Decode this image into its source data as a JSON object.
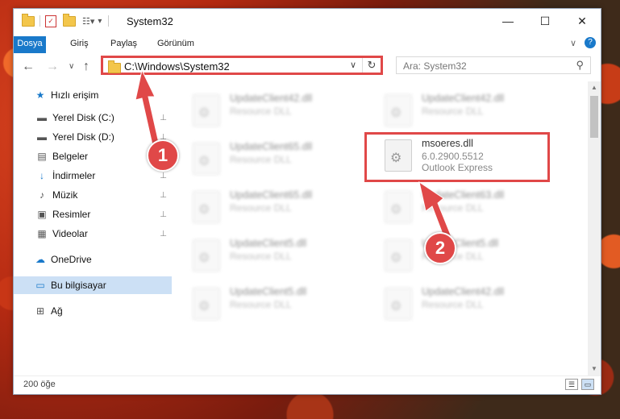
{
  "window": {
    "title": "System32",
    "controls": {
      "minimize": "—",
      "maximize": "☐",
      "close": "✕"
    }
  },
  "ribbon": {
    "tabs": [
      "Dosya",
      "Giriş",
      "Paylaş",
      "Görünüm"
    ],
    "collapse": "∨",
    "help": "?"
  },
  "navigation": {
    "back": "←",
    "forward": "→",
    "recent": "∨",
    "up": "↑",
    "address": "C:\\Windows\\System32",
    "search_placeholder": "Ara: System32"
  },
  "sidebar": {
    "items": [
      {
        "label": "Hızlı erişim",
        "icon": "star-icon",
        "glyph": "★",
        "pinned": false
      },
      {
        "label": "Yerel Disk (C:)",
        "icon": "drive-icon",
        "glyph": "▬",
        "pinned": true
      },
      {
        "label": "Yerel Disk (D:)",
        "icon": "drive-icon",
        "glyph": "▬",
        "pinned": true
      },
      {
        "label": "Belgeler",
        "icon": "documents-icon",
        "glyph": "▤",
        "pinned": true
      },
      {
        "label": "İndirmeler",
        "icon": "download-icon",
        "glyph": "↓",
        "pinned": true
      },
      {
        "label": "Müzik",
        "icon": "music-icon",
        "glyph": "♪",
        "pinned": true
      },
      {
        "label": "Resimler",
        "icon": "pictures-icon",
        "glyph": "▣",
        "pinned": true
      },
      {
        "label": "Videolar",
        "icon": "video-icon",
        "glyph": "▦",
        "pinned": true
      },
      {
        "label": "OneDrive",
        "icon": "cloud-icon",
        "glyph": "☁",
        "pinned": false
      },
      {
        "label": "Bu bilgisayar",
        "icon": "computer-icon",
        "glyph": "▭",
        "pinned": false
      },
      {
        "label": "Ağ",
        "icon": "network-icon",
        "glyph": "⊞",
        "pinned": false
      }
    ],
    "pin_glyph": "📌"
  },
  "files": [
    {
      "name": "UpdateClient42.dll",
      "desc": "Resource DLL",
      "blurred": true
    },
    {
      "name": "UpdateClient65.dll",
      "desc": "Resource DLL",
      "blurred": true
    },
    {
      "name": "UpdateClient65.dll",
      "desc": "Resource DLL",
      "blurred": true
    },
    {
      "name": "msoeres.dll",
      "desc": "6.0.2900.5512",
      "desc2": "Outlook Express",
      "blurred": false
    },
    {
      "name": "UpdateClient42.dll",
      "desc": "Resource DLL",
      "blurred": true
    },
    {
      "name": "UpdateClient63.dll",
      "desc": "Resource DLL",
      "blurred": true
    },
    {
      "name": "UpdateClient5.dll",
      "desc": "Resource DLL",
      "blurred": true
    },
    {
      "name": "UpdateClient5.dll",
      "desc": "Resource DLL",
      "blurred": true
    },
    {
      "name": "UpdateClient5.dll",
      "desc": "Resource DLL",
      "blurred": true
    },
    {
      "name": "UpdateClient42.dll",
      "desc": "Resource DLL",
      "blurred": true
    }
  ],
  "status": {
    "count": "200 öğe"
  },
  "annotations": {
    "callout1": "1",
    "callout2": "2",
    "color": "#e04848"
  }
}
